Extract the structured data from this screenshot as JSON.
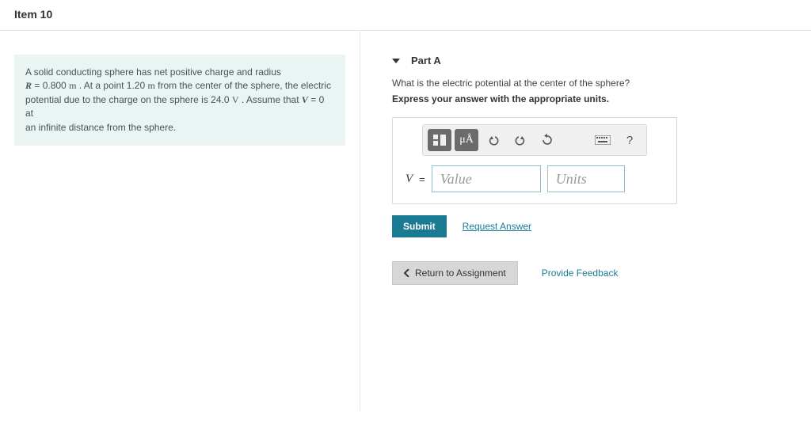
{
  "header": {
    "item_label": "Item 10"
  },
  "problem": {
    "line1_pre": "A solid conducting sphere has net positive charge and radius",
    "R_var": "R",
    "R_eq": " = 0.800 ",
    "R_unit": "m",
    "line2a": " . At a point 1.20 ",
    "m2": "m",
    "line2b": " from the center of the sphere, the electric",
    "line3a": "potential due to the charge on the sphere is 24.0 ",
    "V_unit": "V",
    "line3b": " . Assume that ",
    "V_var": "V",
    "line3c": " = 0 at",
    "line4": "an infinite distance from the sphere."
  },
  "part": {
    "label": "Part A",
    "question": "What is the electric potential at the center of the sphere?",
    "instruction": "Express your answer with the appropriate units."
  },
  "toolbar": {
    "template_icon": "template-button",
    "mu": "μÅ",
    "undo": "undo",
    "redo": "redo",
    "reset": "reset",
    "keyboard": "keyboard",
    "help": "?"
  },
  "answer": {
    "var": "V",
    "eq": "=",
    "value_placeholder": "Value",
    "units_placeholder": "Units"
  },
  "actions": {
    "submit": "Submit",
    "request": "Request Answer",
    "return": "Return to Assignment",
    "feedback": "Provide Feedback"
  }
}
